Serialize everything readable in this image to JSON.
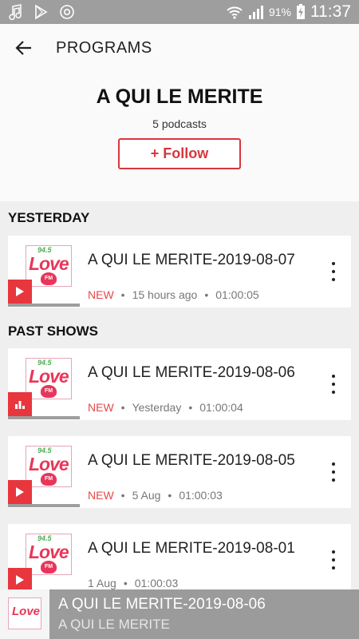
{
  "status_bar": {
    "battery": "91%",
    "time": "11:37",
    "left_icons": [
      "music-note-icon",
      "play-store-icon",
      "chrome-icon"
    ],
    "right_icons": [
      "wifi-icon",
      "signal-icon",
      "battery-charging-icon"
    ]
  },
  "app_bar": {
    "title": "PROGRAMS"
  },
  "program": {
    "title": "A QUI LE MERITE",
    "count": "5 podcasts",
    "follow_label": "+ Follow"
  },
  "logo": {
    "freq": "94.5",
    "word": "Love",
    "heart": "FM"
  },
  "sections": [
    {
      "label": "YESTERDAY",
      "episodes": [
        {
          "title": "A QUI LE MERITE-2019-08-07",
          "badge": "NEW",
          "date": "15 hours ago",
          "duration": "01:00:05",
          "state": "play"
        }
      ]
    },
    {
      "label": "PAST SHOWS",
      "episodes": [
        {
          "title": "A QUI LE MERITE-2019-08-06",
          "badge": "NEW",
          "date": "Yesterday",
          "duration": "01:00:04",
          "state": "playing"
        },
        {
          "title": "A QUI LE MERITE-2019-08-05",
          "badge": "NEW",
          "date": "5 Aug",
          "duration": "01:00:03",
          "state": "play"
        },
        {
          "title": "A QUI LE MERITE-2019-08-01",
          "badge": "",
          "date": "1 Aug",
          "duration": "01:00:03",
          "state": "play"
        }
      ]
    }
  ],
  "mini_player": {
    "title": "A QUI LE MERITE-2019-08-06",
    "subtitle": "A QUI LE MERITE"
  },
  "colors": {
    "accent": "#d9363e",
    "new_badge": "#e54848",
    "status_bar": "#9e9e9e"
  }
}
